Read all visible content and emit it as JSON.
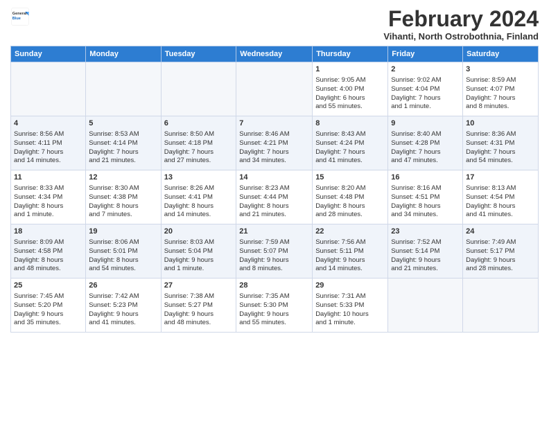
{
  "logo": {
    "general": "General",
    "blue": "Blue"
  },
  "title": {
    "month_year": "February 2024",
    "location": "Vihanti, North Ostrobothnia, Finland"
  },
  "headers": [
    "Sunday",
    "Monday",
    "Tuesday",
    "Wednesday",
    "Thursday",
    "Friday",
    "Saturday"
  ],
  "weeks": [
    [
      {
        "day": "",
        "info": "",
        "empty": true
      },
      {
        "day": "",
        "info": "",
        "empty": true
      },
      {
        "day": "",
        "info": "",
        "empty": true
      },
      {
        "day": "",
        "info": "",
        "empty": true
      },
      {
        "day": "1",
        "info": "Sunrise: 9:05 AM\nSunset: 4:00 PM\nDaylight: 6 hours\nand 55 minutes."
      },
      {
        "day": "2",
        "info": "Sunrise: 9:02 AM\nSunset: 4:04 PM\nDaylight: 7 hours\nand 1 minute."
      },
      {
        "day": "3",
        "info": "Sunrise: 8:59 AM\nSunset: 4:07 PM\nDaylight: 7 hours\nand 8 minutes."
      }
    ],
    [
      {
        "day": "4",
        "info": "Sunrise: 8:56 AM\nSunset: 4:11 PM\nDaylight: 7 hours\nand 14 minutes."
      },
      {
        "day": "5",
        "info": "Sunrise: 8:53 AM\nSunset: 4:14 PM\nDaylight: 7 hours\nand 21 minutes."
      },
      {
        "day": "6",
        "info": "Sunrise: 8:50 AM\nSunset: 4:18 PM\nDaylight: 7 hours\nand 27 minutes."
      },
      {
        "day": "7",
        "info": "Sunrise: 8:46 AM\nSunset: 4:21 PM\nDaylight: 7 hours\nand 34 minutes."
      },
      {
        "day": "8",
        "info": "Sunrise: 8:43 AM\nSunset: 4:24 PM\nDaylight: 7 hours\nand 41 minutes."
      },
      {
        "day": "9",
        "info": "Sunrise: 8:40 AM\nSunset: 4:28 PM\nDaylight: 7 hours\nand 47 minutes."
      },
      {
        "day": "10",
        "info": "Sunrise: 8:36 AM\nSunset: 4:31 PM\nDaylight: 7 hours\nand 54 minutes."
      }
    ],
    [
      {
        "day": "11",
        "info": "Sunrise: 8:33 AM\nSunset: 4:34 PM\nDaylight: 8 hours\nand 1 minute."
      },
      {
        "day": "12",
        "info": "Sunrise: 8:30 AM\nSunset: 4:38 PM\nDaylight: 8 hours\nand 7 minutes."
      },
      {
        "day": "13",
        "info": "Sunrise: 8:26 AM\nSunset: 4:41 PM\nDaylight: 8 hours\nand 14 minutes."
      },
      {
        "day": "14",
        "info": "Sunrise: 8:23 AM\nSunset: 4:44 PM\nDaylight: 8 hours\nand 21 minutes."
      },
      {
        "day": "15",
        "info": "Sunrise: 8:20 AM\nSunset: 4:48 PM\nDaylight: 8 hours\nand 28 minutes."
      },
      {
        "day": "16",
        "info": "Sunrise: 8:16 AM\nSunset: 4:51 PM\nDaylight: 8 hours\nand 34 minutes."
      },
      {
        "day": "17",
        "info": "Sunrise: 8:13 AM\nSunset: 4:54 PM\nDaylight: 8 hours\nand 41 minutes."
      }
    ],
    [
      {
        "day": "18",
        "info": "Sunrise: 8:09 AM\nSunset: 4:58 PM\nDaylight: 8 hours\nand 48 minutes."
      },
      {
        "day": "19",
        "info": "Sunrise: 8:06 AM\nSunset: 5:01 PM\nDaylight: 8 hours\nand 54 minutes."
      },
      {
        "day": "20",
        "info": "Sunrise: 8:03 AM\nSunset: 5:04 PM\nDaylight: 9 hours\nand 1 minute."
      },
      {
        "day": "21",
        "info": "Sunrise: 7:59 AM\nSunset: 5:07 PM\nDaylight: 9 hours\nand 8 minutes."
      },
      {
        "day": "22",
        "info": "Sunrise: 7:56 AM\nSunset: 5:11 PM\nDaylight: 9 hours\nand 14 minutes."
      },
      {
        "day": "23",
        "info": "Sunrise: 7:52 AM\nSunset: 5:14 PM\nDaylight: 9 hours\nand 21 minutes."
      },
      {
        "day": "24",
        "info": "Sunrise: 7:49 AM\nSunset: 5:17 PM\nDaylight: 9 hours\nand 28 minutes."
      }
    ],
    [
      {
        "day": "25",
        "info": "Sunrise: 7:45 AM\nSunset: 5:20 PM\nDaylight: 9 hours\nand 35 minutes."
      },
      {
        "day": "26",
        "info": "Sunrise: 7:42 AM\nSunset: 5:23 PM\nDaylight: 9 hours\nand 41 minutes."
      },
      {
        "day": "27",
        "info": "Sunrise: 7:38 AM\nSunset: 5:27 PM\nDaylight: 9 hours\nand 48 minutes."
      },
      {
        "day": "28",
        "info": "Sunrise: 7:35 AM\nSunset: 5:30 PM\nDaylight: 9 hours\nand 55 minutes."
      },
      {
        "day": "29",
        "info": "Sunrise: 7:31 AM\nSunset: 5:33 PM\nDaylight: 10 hours\nand 1 minute."
      },
      {
        "day": "",
        "info": "",
        "empty": true
      },
      {
        "day": "",
        "info": "",
        "empty": true
      }
    ]
  ]
}
